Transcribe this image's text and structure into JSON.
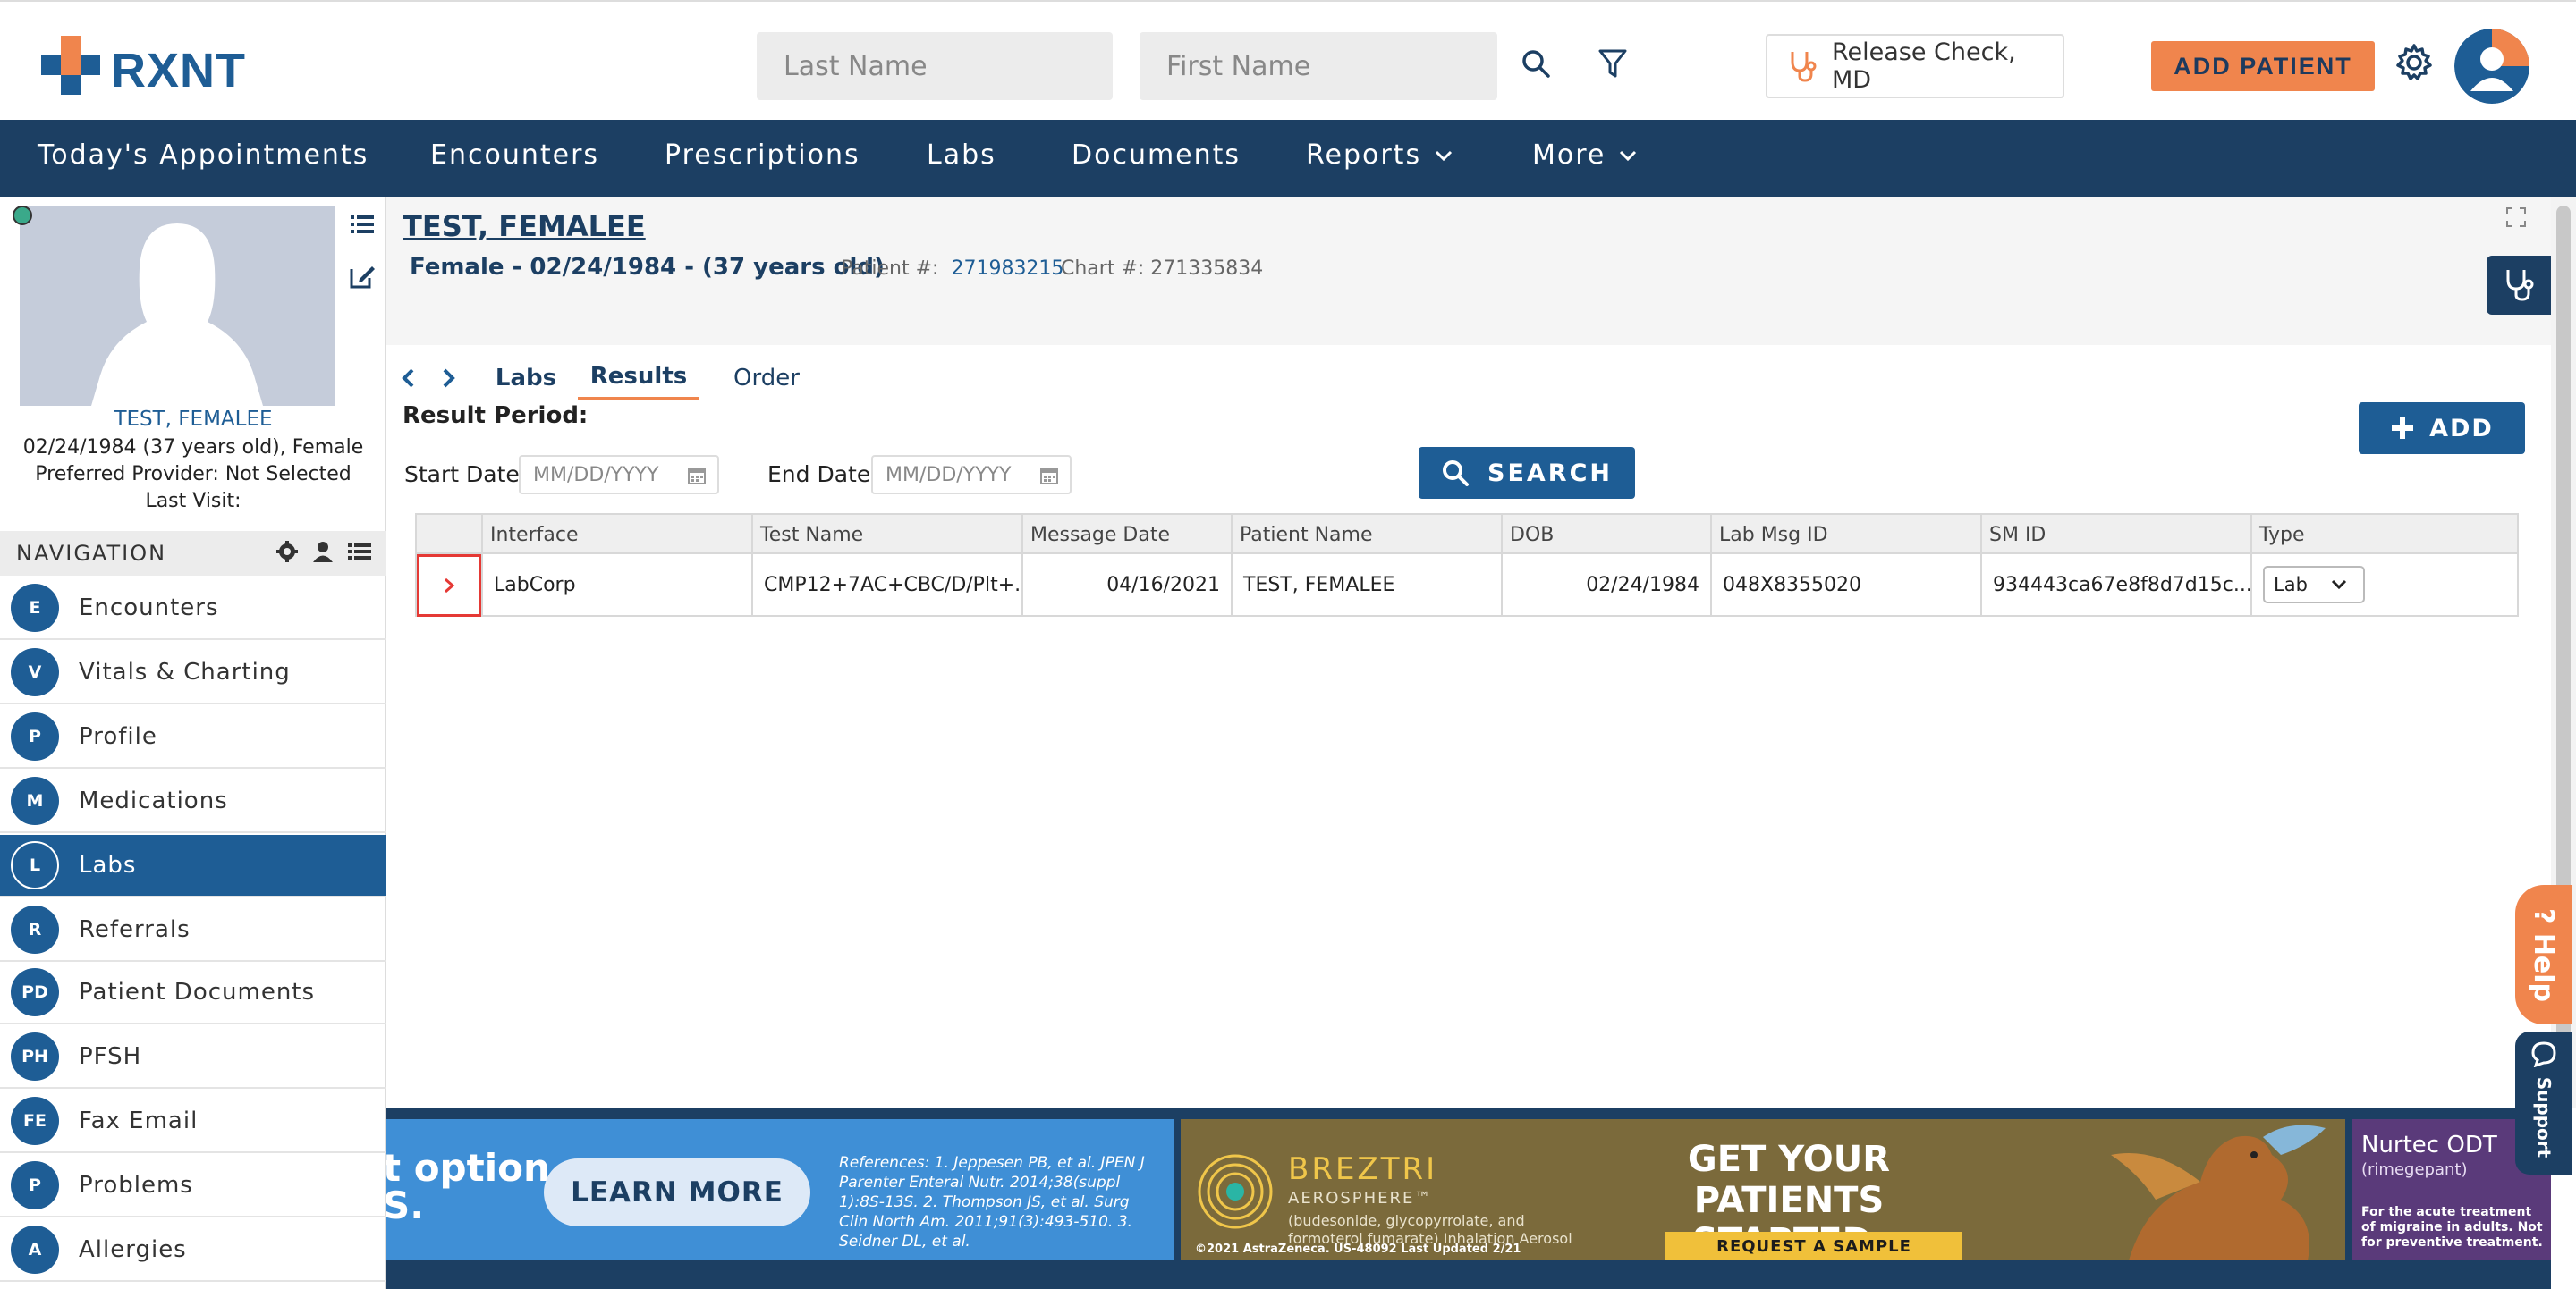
{
  "header": {
    "logo_text": "RXNT",
    "last_name_placeholder": "Last Name",
    "first_name_placeholder": "First Name",
    "provider": "Release Check, MD",
    "add_patient": "ADD PATIENT"
  },
  "topnav": {
    "items": [
      {
        "label": "Today's Appointments"
      },
      {
        "label": "Encounters"
      },
      {
        "label": "Prescriptions"
      },
      {
        "label": "Labs"
      },
      {
        "label": "Documents"
      },
      {
        "label": "Reports"
      },
      {
        "label": "More"
      }
    ]
  },
  "patient_card": {
    "name": "TEST, FEMALEE",
    "dob_line": "02/24/1984 (37 years old), Female",
    "provider_line": "Preferred Provider: Not Selected",
    "last_visit": "Last Visit:"
  },
  "sidenav": {
    "heading": "NAVIGATION",
    "items": [
      {
        "badge": "E",
        "label": "Encounters"
      },
      {
        "badge": "V",
        "label": "Vitals & Charting"
      },
      {
        "badge": "P",
        "label": "Profile"
      },
      {
        "badge": "M",
        "label": "Medications"
      },
      {
        "badge": "L",
        "label": "Labs"
      },
      {
        "badge": "R",
        "label": "Referrals"
      },
      {
        "badge": "PD",
        "label": "Patient Documents"
      },
      {
        "badge": "PH",
        "label": "PFSH"
      },
      {
        "badge": "FE",
        "label": "Fax Email"
      },
      {
        "badge": "P",
        "label": "Problems"
      },
      {
        "badge": "A",
        "label": "Allergies"
      }
    ],
    "active_index": 4
  },
  "patient_header": {
    "title": "TEST, FEMALEE",
    "summary": "Female - 02/24/1984 - (37 years old)",
    "patient_num_label": "Patient #:",
    "patient_num": "271983215",
    "chart_num": "Chart #: 271335834"
  },
  "labs": {
    "breadcrumb": "Labs",
    "tabs": [
      {
        "label": "Results"
      },
      {
        "label": "Order"
      }
    ],
    "active_tab": "Results",
    "result_period": "Result Period:",
    "add_label": "ADD",
    "start_date_label": "Start Date",
    "end_date_label": "End Date",
    "date_placeholder": "MM/DD/YYYY",
    "search_label": "SEARCH",
    "columns": [
      "Interface",
      "Test Name",
      "Message Date",
      "Patient Name",
      "DOB",
      "Lab Msg ID",
      "SM ID",
      "Type"
    ],
    "rows": [
      {
        "interface": "LabCorp",
        "test_name": "CMP12+7AC+CBC/D/Plt+...",
        "message_date": "04/16/2021",
        "patient_name": "TEST, FEMALEE",
        "dob": "02/24/1984",
        "lab_msg_id": "048X8355020",
        "sm_id": "934443ca67e8f8d7d15c...",
        "type": "Lab"
      }
    ]
  },
  "ads": {
    "ad1_headline": "t option\nS.",
    "ad1_button": "LEARN MORE",
    "ad1_refs": "References: 1. Jeppesen PB, et al. JPEN J Parenter Enteral Nutr. 2014;38(suppl 1):8S-13S. 2. Thompson JS, et al. Surg Clin North Am. 2011;91(3):493-510. 3. Seidner DL, et al.",
    "ad2_brand": "BREZTRI",
    "ad2_sub": "AEROSPHERE™",
    "ad2_generic": "(budesonide, glycopyrrolate, and formoterol fumarate) Inhalation Aerosol",
    "ad2_footer": "©2021 AstraZeneca. US-48092  Last Updated 2/21",
    "ad2_headline": "GET YOUR PATIENTS STARTED.",
    "ad2_cta": "REQUEST A SAMPLE",
    "ad3_brand": "Nurtec ODT",
    "ad3_generic": "(rimegepant)",
    "ad3_text": "For the acute treatment of migraine in adults. Not for preventive treatment."
  },
  "floating": {
    "help": "? Help",
    "support": "Support"
  },
  "colors": {
    "navy": "#1c3f63",
    "blue": "#1e5d95",
    "orange": "#f0854d",
    "highlight": "#e53935"
  }
}
